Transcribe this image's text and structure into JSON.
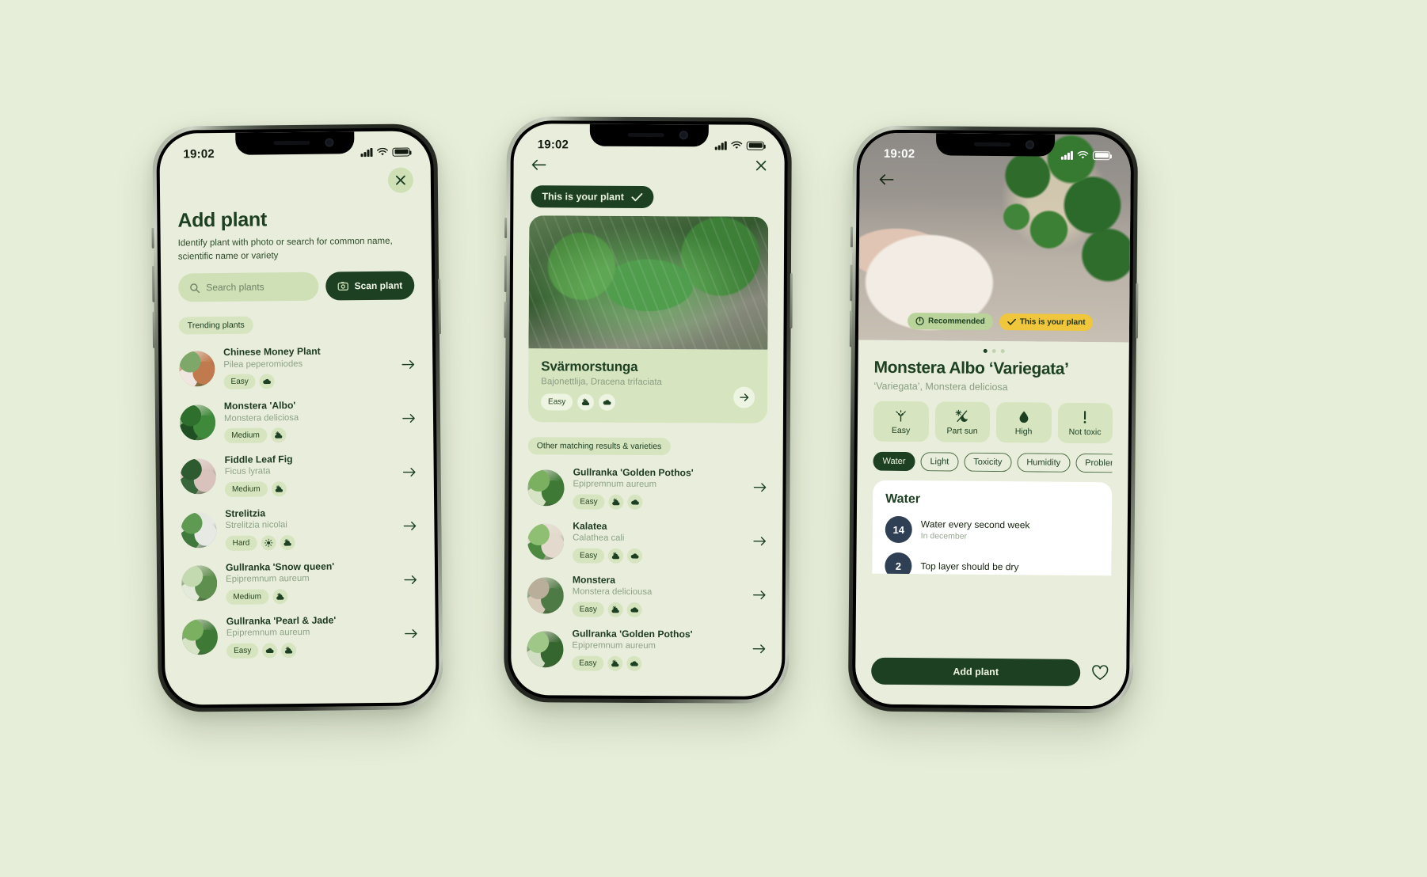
{
  "status": {
    "time": "19:02"
  },
  "phone1": {
    "close_icon": "close-icon",
    "title": "Add plant",
    "subtitle": "Identify plant with photo or search for common name, scientific name or variety",
    "search_placeholder": "Search plants",
    "scan_label": "Scan plant",
    "section_label": "Trending plants",
    "plants": [
      {
        "name": "Chinese Money Plant",
        "sci": "Pilea peperomiodes",
        "care": "Easy",
        "icons": [
          "cloud"
        ]
      },
      {
        "name": "Monstera 'Albo'",
        "sci": "Monstera deliciosa",
        "care": "Medium",
        "icons": [
          "sun-cloud"
        ]
      },
      {
        "name": "Fiddle Leaf Fig",
        "sci": "Ficus lyrata",
        "care": "Medium",
        "icons": [
          "sun-cloud"
        ]
      },
      {
        "name": "Strelitzia",
        "sci": "Strelitzia nicolai",
        "care": "Hard",
        "icons": [
          "sun",
          "sun-cloud"
        ]
      },
      {
        "name": "Gullranka 'Snow queen'",
        "sci": "Epipremnum aureum",
        "care": "Medium",
        "icons": [
          "sun-cloud"
        ]
      },
      {
        "name": "Gullranka 'Pearl & Jade'",
        "sci": "Epipremnum aureum",
        "care": "Easy",
        "icons": [
          "cloud",
          "sun-cloud"
        ]
      }
    ]
  },
  "phone2": {
    "back_icon": "back-arrow-icon",
    "close_icon": "close-icon",
    "banner": "This is your plant",
    "card": {
      "title": "Svärmorstunga",
      "sci": "Bajonettlija, Dracena trifaciata",
      "care": "Easy",
      "icons": [
        "sun-cloud",
        "cloud"
      ]
    },
    "section_label": "Other matching results & varieties",
    "results": [
      {
        "name": "Gullranka 'Golden Pothos'",
        "sci": "Epipremnum aureum",
        "care": "Easy",
        "icons": [
          "sun-cloud",
          "cloud"
        ]
      },
      {
        "name": "Kalatea",
        "sci": "Calathea cali",
        "care": "Easy",
        "icons": [
          "sun-cloud",
          "cloud"
        ]
      },
      {
        "name": "Monstera",
        "sci": "Monstera deliciousa",
        "care": "Easy",
        "icons": [
          "sun-cloud",
          "cloud"
        ]
      },
      {
        "name": "Gullranka 'Golden Pothos'",
        "sci": "Epipremnum aureum",
        "care": "Easy",
        "icons": [
          "sun-cloud",
          "cloud"
        ]
      }
    ]
  },
  "phone3": {
    "back_icon": "back-arrow-icon",
    "badge_recommended": "Recommended",
    "badge_your_plant": "This is your plant",
    "title": "Monstera Albo ‘Variegata’",
    "sub": "‘Variegata’, Monstera deliciosa",
    "stats": [
      {
        "label": "Easy",
        "icon": "sprout-icon"
      },
      {
        "label": "Part sun",
        "icon": "part-sun-icon"
      },
      {
        "label": "High",
        "icon": "water-drop-icon"
      },
      {
        "label": "Not toxic",
        "icon": "exclamation-icon"
      }
    ],
    "tabs": [
      "Water",
      "Light",
      "Toxicity",
      "Humidity",
      "Problems & Pe"
    ],
    "active_tab": "Water",
    "water": {
      "heading": "Water",
      "rows": [
        {
          "num": "14",
          "main": "Water every second week",
          "sub": "In december"
        },
        {
          "num": "2",
          "main": "Top layer should be dry",
          "sub": ""
        }
      ]
    },
    "add_label": "Add plant",
    "favorite_icon": "heart-icon"
  },
  "colors": {
    "bg": "#e6edd9",
    "screen_bg": "#e8eedb",
    "dark_green": "#1d4023",
    "light_green": "#d6e4bf",
    "yellow": "#f0c63c"
  }
}
